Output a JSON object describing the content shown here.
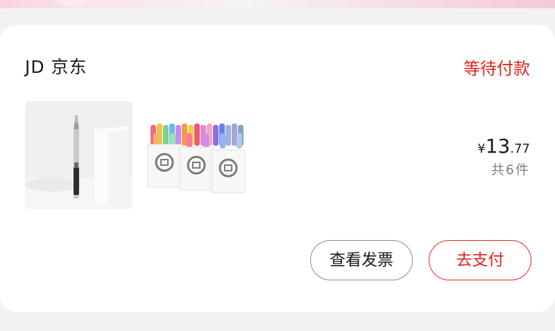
{
  "order": {
    "store_name": "JD 京东",
    "status": "等待付款",
    "products": [
      {
        "icon": "utility-knife-image"
      },
      {
        "icon": "marker-pen-set-image"
      }
    ],
    "price": {
      "currency": "¥",
      "integer": "13",
      "decimal": ".77"
    },
    "item_count": "共6件",
    "actions": {
      "view_invoice": "查看发票",
      "pay": "去支付"
    }
  },
  "colors": {
    "accent": "#e2231a",
    "muted_text": "#808080",
    "primary_text": "#1a1a1a"
  }
}
